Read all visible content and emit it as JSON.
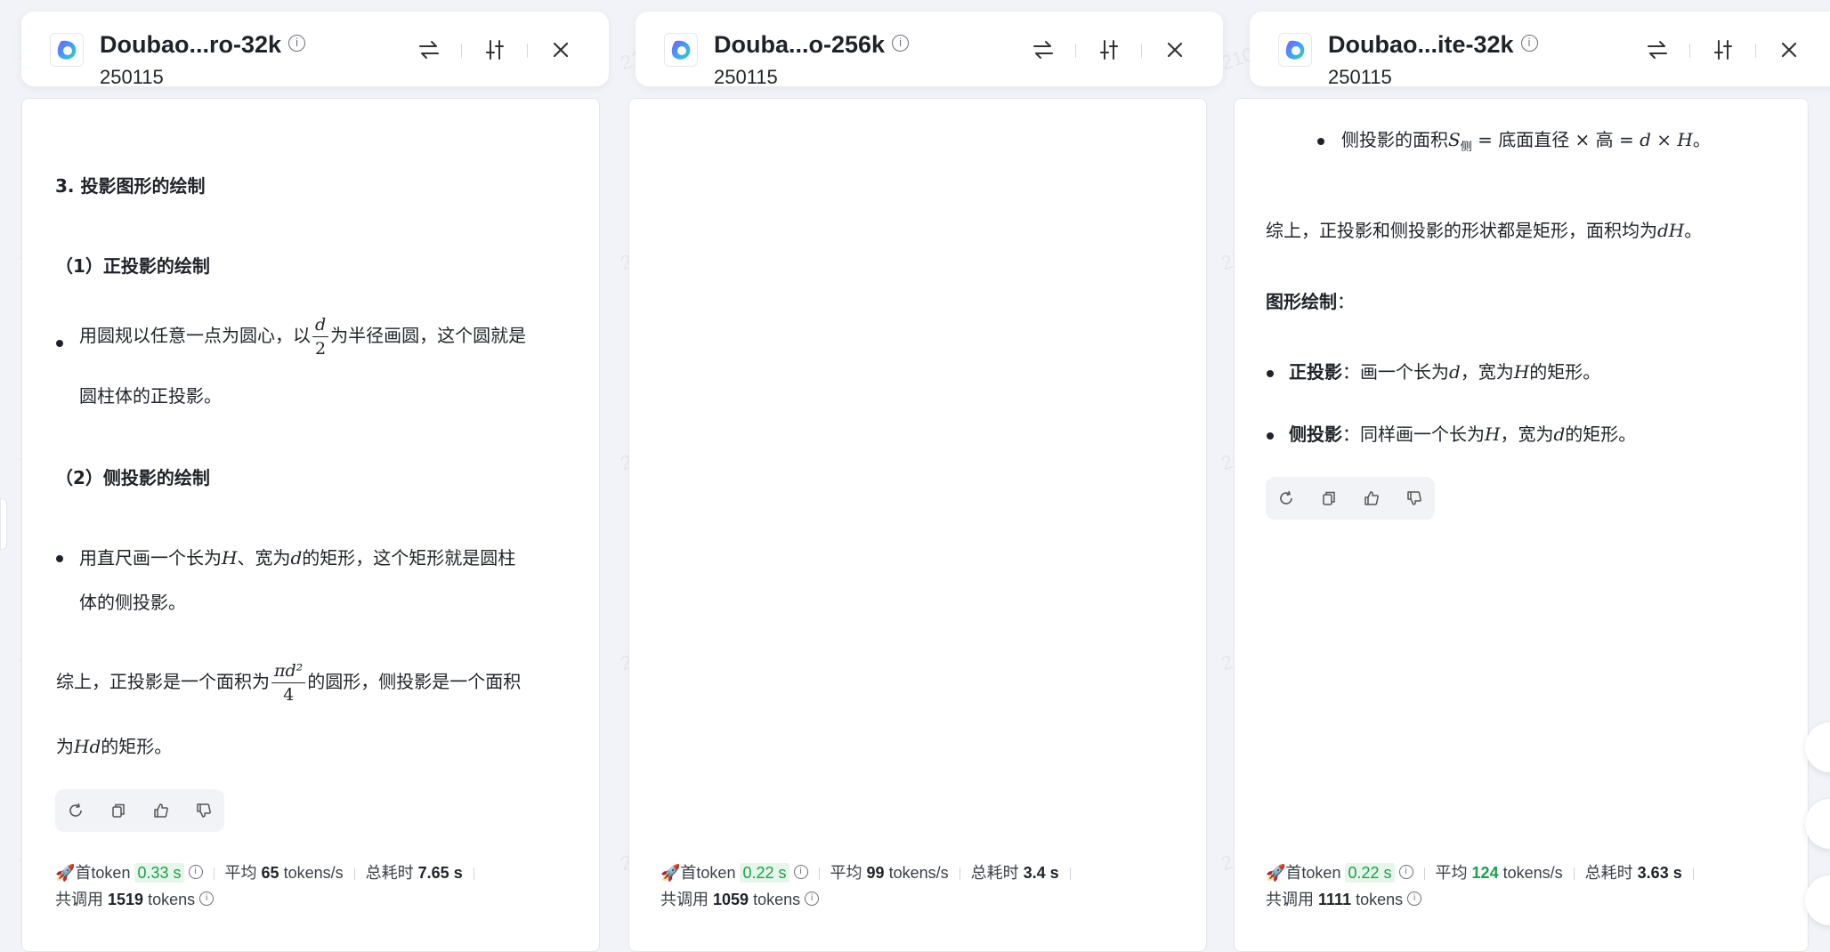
{
  "columns": [
    {
      "model_name": "Doubao...ro-32k",
      "version": "250115",
      "icons": [
        "swap-icon",
        "settings-sliders-icon",
        "close-icon"
      ],
      "content": {
        "heading": "3. 投影图形的绘制",
        "sub1": "（1）正投影的绘制",
        "b1_line1_pre": "用圆规以任意一点为圆心，以",
        "b1_frac_num": "d",
        "b1_frac_den": "2",
        "b1_line1_post": "为半径画圆，这个圆就是",
        "b1_line2": "圆柱体的正投影。",
        "sub2": "（2）侧投影的绘制",
        "b2_line1_pre": "用直尺画一个长为",
        "b2_var1": "H",
        "b2_mid": "、宽为",
        "b2_var2": "d",
        "b2_line1_post": "的矩形，这个矩形就是圆柱",
        "b2_line2": "体的侧投影。",
        "sum_line1_pre": "综上，正投影是一个面积为",
        "sum_frac_num": "πd²",
        "sum_frac_den": "4",
        "sum_line1_post": "的圆形，侧投影是一个面积",
        "sum_line2_pre": "为",
        "sum_var": "Hd",
        "sum_line2_post": "的矩形。"
      },
      "stats": {
        "first_token_label": "首token",
        "first_token": "0.33 s",
        "avg_label": "平均",
        "avg_value": "65",
        "avg_unit": "tokens/s",
        "total_time_label": "总耗时",
        "total_time": "7.65 s",
        "total_tokens_label": "共调用",
        "total_tokens": "1519",
        "total_tokens_unit": "tokens"
      }
    },
    {
      "model_name": "Douba...o-256k",
      "version": "250115",
      "icons": [
        "swap-icon",
        "settings-sliders-icon",
        "close-icon"
      ],
      "stats": {
        "first_token_label": "首token",
        "first_token": "0.22 s",
        "avg_label": "平均",
        "avg_value": "99",
        "avg_unit": "tokens/s",
        "total_time_label": "总耗时",
        "total_time": "3.4 s",
        "total_tokens_label": "共调用",
        "total_tokens": "1059",
        "total_tokens_unit": "tokens"
      }
    },
    {
      "model_name": "Doubao...ite-32k",
      "version": "250115",
      "icons": [
        "swap-icon",
        "settings-sliders-icon",
        "close-icon"
      ],
      "content": {
        "b0_pre": "侧投影的面积",
        "b0_var": "S",
        "b0_sub": "侧",
        "b0_eq": " = 底面直径 × 高 = ",
        "b0_expr": "d × H",
        "b0_post": "。",
        "sum_pre": "综上，正投影和侧投影的形状都是矩形，面积均为",
        "sum_var": "dH",
        "sum_post": "。",
        "draw_title": "图形绘制",
        "draw_colon": "：",
        "p1_bold": "正投影",
        "p1_pre": "：画一个长为",
        "p1_var1": "d",
        "p1_mid": "，宽为",
        "p1_var2": "H",
        "p1_post": "的矩形。",
        "p2_bold": "侧投影",
        "p2_pre": "：同样画一个长为",
        "p2_var1": "H",
        "p2_mid": "，宽为",
        "p2_var2": "d",
        "p2_post": "的矩形。"
      },
      "stats": {
        "first_token_label": "首token",
        "first_token": "0.22 s",
        "avg_label": "平均",
        "avg_value": "124",
        "avg_unit": "tokens/s",
        "total_time_label": "总耗时",
        "total_time": "3.63 s",
        "total_tokens_label": "共调用",
        "total_tokens": "1111",
        "total_tokens_unit": "tokens"
      }
    }
  ],
  "watermark_text": "2103798236",
  "colors": {
    "accent_green": "#1f9e4a",
    "highlight_bg": "#e6f6ea",
    "panel_bg": "#ffffff",
    "page_bg": "#f1f3f8"
  }
}
